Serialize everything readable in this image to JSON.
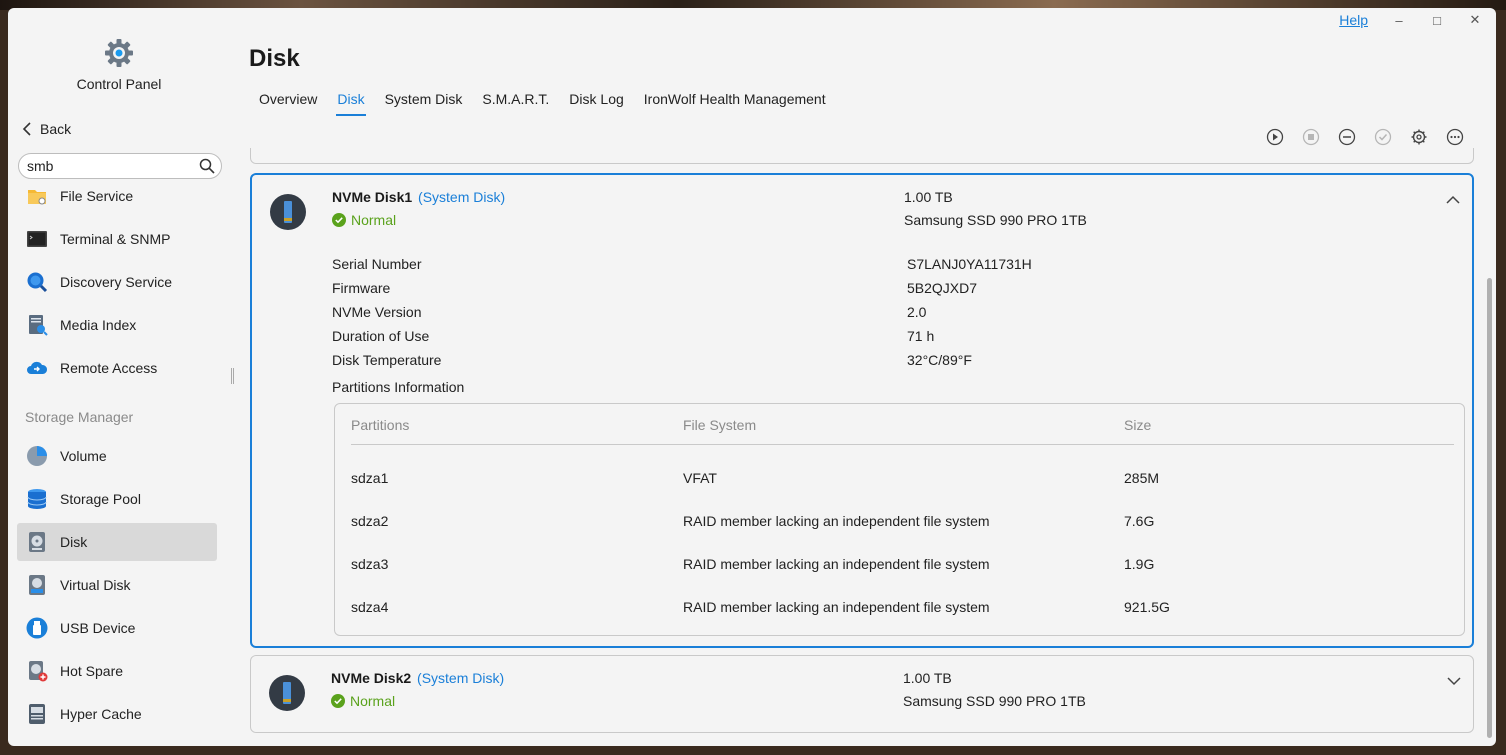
{
  "window": {
    "help_label": "Help"
  },
  "sidebar": {
    "title": "Control Panel",
    "back_label": "Back",
    "search_value": "smb",
    "section_label": "Storage Manager",
    "items_top": [
      {
        "label": "File Service"
      },
      {
        "label": "Terminal & SNMP"
      },
      {
        "label": "Discovery Service"
      },
      {
        "label": "Media Index"
      },
      {
        "label": "Remote Access"
      }
    ],
    "items_storage": [
      {
        "label": "Volume"
      },
      {
        "label": "Storage Pool"
      },
      {
        "label": "Disk"
      },
      {
        "label": "Virtual Disk"
      },
      {
        "label": "USB Device"
      },
      {
        "label": "Hot Spare"
      },
      {
        "label": "Hyper Cache"
      }
    ]
  },
  "main": {
    "title": "Disk",
    "tabs": [
      {
        "label": "Overview"
      },
      {
        "label": "Disk"
      },
      {
        "label": "System Disk"
      },
      {
        "label": "S.M.A.R.T."
      },
      {
        "label": "Disk Log"
      },
      {
        "label": "IronWolf Health Management"
      }
    ],
    "active_tab": "Disk"
  },
  "disks": [
    {
      "name": "NVMe Disk1",
      "tag": "(System Disk)",
      "status": "Normal",
      "capacity": "1.00 TB",
      "model": "Samsung SSD 990 PRO 1TB",
      "expanded": true,
      "details": [
        {
          "label": "Serial Number",
          "value": "S7LANJ0YA11731H"
        },
        {
          "label": "Firmware",
          "value": "5B2QJXD7"
        },
        {
          "label": "NVMe Version",
          "value": "2.0"
        },
        {
          "label": "Duration of Use",
          "value": "71 h"
        },
        {
          "label": "Disk Temperature",
          "value": "32°C/89°F"
        }
      ],
      "partitions_title": "Partitions Information",
      "partition_headers": [
        "Partitions",
        "File System",
        "Size"
      ],
      "partitions": [
        {
          "name": "sdza1",
          "fs": "VFAT",
          "size": "285M"
        },
        {
          "name": "sdza2",
          "fs": "RAID member lacking an independent file system",
          "size": "7.6G"
        },
        {
          "name": "sdza3",
          "fs": "RAID member lacking an independent file system",
          "size": "1.9G"
        },
        {
          "name": "sdza4",
          "fs": "RAID member lacking an independent file system",
          "size": "921.5G"
        }
      ]
    },
    {
      "name": "NVMe Disk2",
      "tag": "(System Disk)",
      "status": "Normal",
      "capacity": "1.00 TB",
      "model": "Samsung SSD 990 PRO 1TB",
      "expanded": false
    }
  ],
  "colors": {
    "accent": "#1a7fd8",
    "status_ok": "#5aa21c",
    "active_nav_bg": "#d9d9d9"
  },
  "icons": {
    "toolbar": [
      "play-circle-icon",
      "stop-circle-icon",
      "minus-circle-icon",
      "check-circle-icon",
      "gear-icon",
      "more-circle-icon"
    ]
  }
}
